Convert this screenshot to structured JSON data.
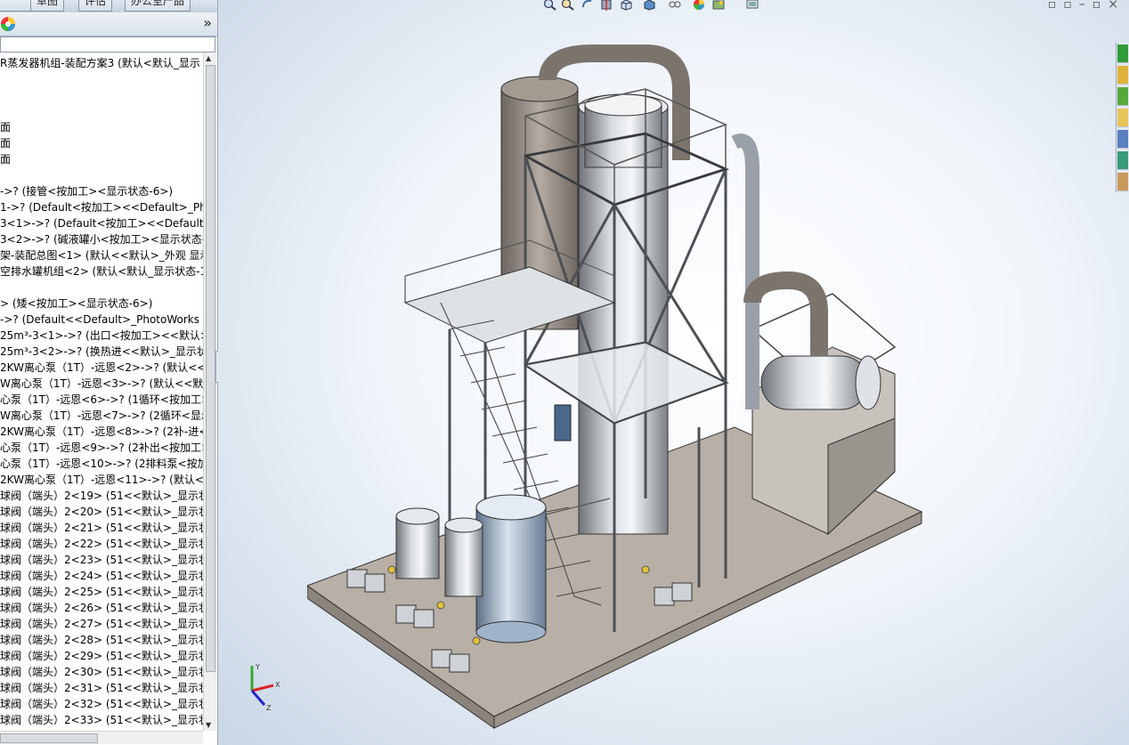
{
  "tabs": [
    "",
    "草图",
    "评估",
    "办公室产品"
  ],
  "tree": {
    "root": "R蒸发器机组-装配方案3  (默认<默认_显示",
    "rows": [
      "",
      "",
      "面",
      "面",
      "面",
      "",
      "->? (接管<按加工><显示状态-6>)",
      "1->? (Default<按加工><<Default>_Pho",
      "3<1>->? (Default<按加工><<Default>",
      "3<2>->? (碱液罐小<按加工><显示状态-",
      "架-装配总图<1> (默认<<默认>_外观 显示",
      "空排水罐机组<2> (默认<默认_显示状态-1",
      "",
      "> (矮<按加工><显示状态-6>)",
      "->? (Default<<Default>_PhotoWorks I",
      "25m³-3<1>->? (出口<按加工><<默认>",
      "25m³-3<2>->? (换热进<<默认>_显示状",
      "2KW离心泵（1T）-远恩<2>->? (默认<<默",
      "W离心泵（1T）-远恩<3>->? (默认<<默认",
      "心泵（1T）-远恩<6>->? (1循环<按加工>",
      "W离心泵（1T）-远恩<7>->? (2循环<显示",
      "2KW离心泵（1T）-远恩<8>->? (2补-进<",
      "心泵（1T）-远恩<9>->? (2补出<按加工>",
      "心泵（1T）-远恩<10>->? (2排料泵<按加",
      "2KW离心泵（1T）-远恩<11>->? (默认<<",
      "球阀（端头）2<19> (51<<默认>_显示状态",
      "球阀（端头）2<20> (51<<默认>_显示状态",
      "球阀（端头）2<21> (51<<默认>_显示状态",
      "球阀（端头）2<22> (51<<默认>_显示状态",
      "球阀（端头）2<23> (51<<默认>_显示状态",
      "球阀（端头）2<24> (51<<默认>_显示状态",
      "球阀（端头）2<25> (51<<默认>_显示状态",
      "球阀（端头）2<26> (51<<默认>_显示状态",
      "球阀（端头）2<27> (51<<默认>_显示状态",
      "球阀（端头）2<28> (51<<默认>_显示状态",
      "球阀（端头）2<29> (51<<默认>_显示状态",
      "球阀（端头）2<30> (51<<默认>_显示状态",
      "球阀（端头）2<31> (51<<默认>_显示状态",
      "球阀（端头）2<32> (51<<默认>_显示状态",
      "球阀（端头）2<33> (51<<默认>_显示状态"
    ]
  },
  "expand": "»",
  "collapse": "◂",
  "window_controls": "▫▫–▫×",
  "triad_labels": {
    "x": "X",
    "y": "Y",
    "z": "Z"
  },
  "icons": [
    "zoom-to-fit-icon",
    "zoom-area-icon",
    "previous-view-icon",
    "section-view-icon",
    "view-orientation-icon",
    "display-style-icon",
    "hide-show-icon",
    "appearance-icon",
    "scene-icon",
    "view-settings-icon"
  ],
  "colors": {
    "accent": "#3a6ea5",
    "panel_bg": "#ffffff",
    "viewport_edge": "#c9d6e6"
  }
}
